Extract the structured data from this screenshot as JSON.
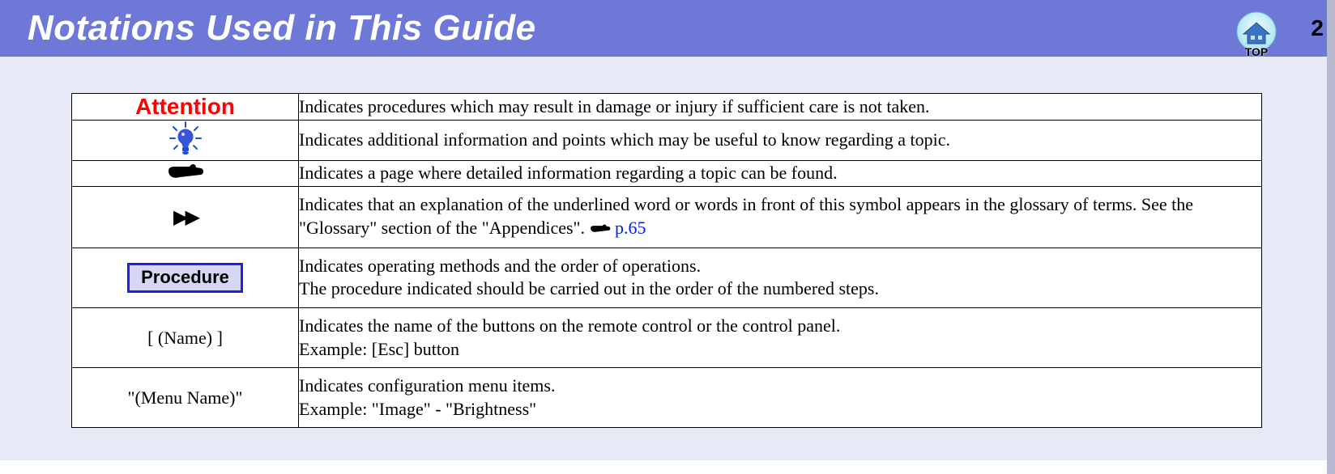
{
  "header": {
    "title": "Notations Used in This Guide",
    "page_number": "2",
    "top_label": "TOP"
  },
  "rows": {
    "attention": {
      "symbol_label": "Attention",
      "desc": "Indicates procedures which may result in damage or injury if sufficient care is not taken."
    },
    "tip": {
      "symbol_name": "lightbulb-tip-icon",
      "desc": "Indicates additional information and points which may be useful to know regarding a topic."
    },
    "page_ref": {
      "symbol_name": "pointing-hand-icon",
      "desc": "Indicates a page where detailed information regarding a topic can be found."
    },
    "glossary": {
      "symbol_name": "fast-forward-icon",
      "desc_before": "Indicates that an explanation of the underlined word or words in front of this symbol appears in the glossary of terms. See the \"Glossary\" section of the \"Appendices\". ",
      "link_label": "p.65"
    },
    "procedure": {
      "symbol_label": "Procedure",
      "desc_line1": "Indicates operating methods and the order of operations.",
      "desc_line2": "The procedure indicated should be carried out in the order of the numbered steps."
    },
    "name_button": {
      "symbol_label": "[ (Name) ]",
      "desc_line1": "Indicates the name of the buttons on the remote control or the control panel.",
      "desc_line2": "Example: [Esc] button"
    },
    "menu_name": {
      "symbol_label": "\"(Menu Name)\"",
      "desc_line1": "Indicates configuration menu items.",
      "desc_line2": "Example: \"Image\" - \"Brightness\""
    }
  }
}
